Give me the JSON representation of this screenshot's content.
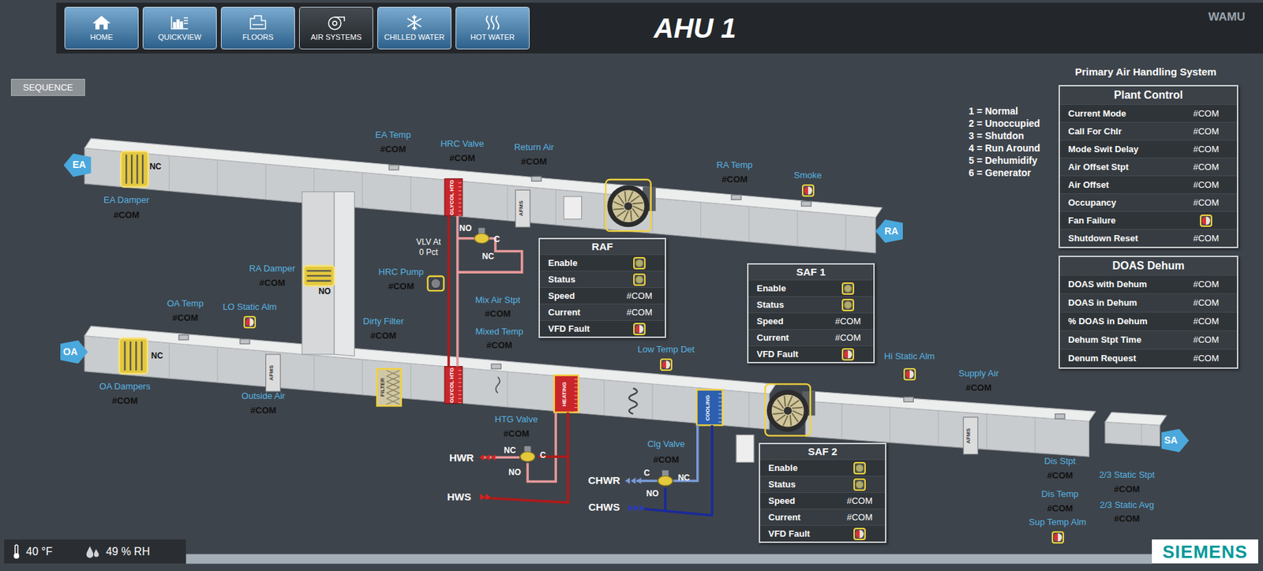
{
  "nav": {
    "buttons": [
      {
        "label": "HOME",
        "selected": false
      },
      {
        "label": "QUICKVIEW",
        "selected": false
      },
      {
        "label": "FLOORS",
        "selected": false
      },
      {
        "label": "AIR SYSTEMS",
        "selected": true
      },
      {
        "label": "CHILLED WATER",
        "selected": false
      },
      {
        "label": "HOT WATER",
        "selected": false
      }
    ]
  },
  "header": {
    "title": "AHU 1",
    "site": "WAMU"
  },
  "sequence_button": {
    "label": "SEQUENCE"
  },
  "system_title": "Primary Air Handling System",
  "mode_legend": [
    "1 = Normal",
    "2 = Unoccupied",
    "3 = Shutdon",
    "4 = Run Around",
    "5 = Dehumidify",
    "6 = Generator"
  ],
  "plant_control": {
    "title": "Plant Control",
    "rows": [
      {
        "label": "Current Mode",
        "kind": "value",
        "value": "#COM"
      },
      {
        "label": "Call For Chlr",
        "kind": "value",
        "value": "#COM"
      },
      {
        "label": "Mode Swit Delay",
        "kind": "value",
        "value": "#COM"
      },
      {
        "label": "Air Offset Stpt",
        "kind": "value",
        "value": "#COM"
      },
      {
        "label": "Air Offset",
        "kind": "value",
        "value": "#COM"
      },
      {
        "label": "Occupancy",
        "kind": "value",
        "value": "#COM"
      },
      {
        "label": "Fan Failure",
        "kind": "alarm"
      },
      {
        "label": "Shutdown Reset",
        "kind": "value",
        "value": "#COM"
      }
    ]
  },
  "doas_dehum": {
    "title": "DOAS Dehum",
    "rows": [
      {
        "label": "DOAS with Dehum",
        "kind": "value",
        "value": "#COM"
      },
      {
        "label": "DOAS in Dehum",
        "kind": "value",
        "value": "#COM"
      },
      {
        "label": "% DOAS in Dehum",
        "kind": "value",
        "value": "#COM"
      },
      {
        "label": "Dehum Stpt Time",
        "kind": "value",
        "value": "#COM"
      },
      {
        "label": "Denum Request",
        "kind": "value",
        "value": "#COM"
      }
    ]
  },
  "fans": [
    {
      "title": "RAF",
      "rows": [
        {
          "label": "Enable",
          "kind": "status"
        },
        {
          "label": "Status",
          "kind": "status"
        },
        {
          "label": "Speed",
          "kind": "value",
          "value": "#COM"
        },
        {
          "label": "Current",
          "kind": "value",
          "value": "#COM"
        },
        {
          "label": "VFD Fault",
          "kind": "alarm"
        }
      ]
    },
    {
      "title": "SAF 1",
      "rows": [
        {
          "label": "Enable",
          "kind": "status"
        },
        {
          "label": "Status",
          "kind": "status"
        },
        {
          "label": "Speed",
          "kind": "value",
          "value": "#COM"
        },
        {
          "label": "Current",
          "kind": "value",
          "value": "#COM"
        },
        {
          "label": "VFD Fault",
          "kind": "alarm"
        }
      ]
    },
    {
      "title": "SAF 2",
      "rows": [
        {
          "label": "Enable",
          "kind": "status"
        },
        {
          "label": "Status",
          "kind": "status"
        },
        {
          "label": "Speed",
          "kind": "value",
          "value": "#COM"
        },
        {
          "label": "Current",
          "kind": "value",
          "value": "#COM"
        },
        {
          "label": "VFD Fault",
          "kind": "alarm"
        }
      ]
    }
  ],
  "points": [
    {
      "label": "EA Temp",
      "kind": "value",
      "value": "#COM"
    },
    {
      "label": "HRC Valve",
      "kind": "value",
      "value": "#COM"
    },
    {
      "label": "Return Air",
      "kind": "value",
      "value": "#COM"
    },
    {
      "label": "RA Temp",
      "kind": "value",
      "value": "#COM"
    },
    {
      "label": "Smoke",
      "kind": "alarm"
    },
    {
      "label": "EA Damper",
      "kind": "value",
      "value": "#COM"
    },
    {
      "label": "RA Damper",
      "kind": "value",
      "value": "#COM"
    },
    {
      "label": "HRC Pump",
      "kind": "value",
      "value": "#COM"
    },
    {
      "label": "Mix Air Stpt",
      "kind": "value",
      "value": "#COM"
    },
    {
      "label": "Mixed Temp",
      "kind": "value",
      "value": "#COM"
    },
    {
      "label": "OA Temp",
      "kind": "value",
      "value": "#COM"
    },
    {
      "label": "LO Static Alm",
      "kind": "alarm"
    },
    {
      "label": "Dirty Filter",
      "kind": "value",
      "value": "#COM"
    },
    {
      "label": "OA Dampers",
      "kind": "value",
      "value": "#COM"
    },
    {
      "label": "Outside Air",
      "kind": "value",
      "value": "#COM"
    },
    {
      "label": "Low Temp Det",
      "kind": "alarm"
    },
    {
      "label": "Hi Static Alm",
      "kind": "alarm"
    },
    {
      "label": "Supply Air",
      "kind": "value",
      "value": "#COM"
    },
    {
      "label": "HTG Valve",
      "kind": "value",
      "value": "#COM"
    },
    {
      "label": "Clg Valve",
      "kind": "value",
      "value": "#COM"
    },
    {
      "label": "Dis Stpt",
      "kind": "value",
      "value": "#COM"
    },
    {
      "label": "2/3 Static Stpt",
      "kind": "value",
      "value": "#COM"
    },
    {
      "label": "Dis Temp",
      "kind": "value",
      "value": "#COM"
    },
    {
      "label": "2/3 Static Avg",
      "kind": "value",
      "value": "#COM"
    },
    {
      "label": "Sup Temp Alm",
      "kind": "alarm"
    }
  ],
  "valve_note": [
    "VLV At",
    "0 Pct"
  ],
  "tags": [
    "NC",
    "NO",
    "NC",
    "NO",
    "C",
    "NC",
    "NC",
    "C",
    "NO",
    "C",
    "NC",
    "NO"
  ],
  "pipe_labels": [
    "HWR",
    "HWS",
    "CHWR",
    "CHWS"
  ],
  "flows": [
    "EA",
    "OA",
    "RA",
    "SA"
  ],
  "equipment": [
    "GLYCOL HTG",
    "GLYCOL HTG",
    "HEATING",
    "COOLING",
    "FILTER",
    "AFMS",
    "AFMS",
    "AFMS"
  ],
  "status_bar": {
    "temperature": "40 °F",
    "humidity": "49 % RH"
  },
  "logo": "SIEMENS"
}
